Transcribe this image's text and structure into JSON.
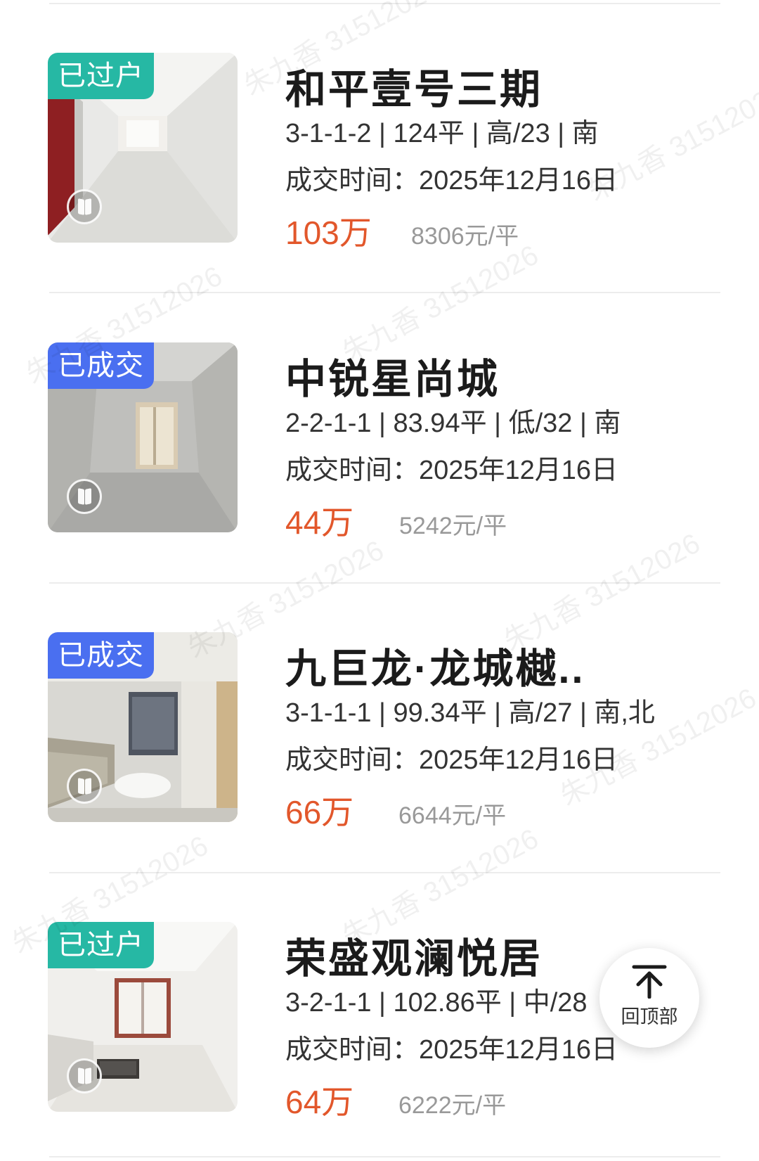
{
  "listings": [
    {
      "status": "已过户",
      "title": "和平壹号三期",
      "specs": "3-1-1-2 | 124平 | 高/23 | 南",
      "deal_date": "成交时间：2025年12月16日",
      "price": "103万",
      "unit_price": "8306元/平",
      "status_color": "#26b8a4"
    },
    {
      "status": "已成交",
      "title": "中锐星尚城",
      "specs": "2-2-1-1 | 83.94平 | 低/32 | 南",
      "deal_date": "成交时间：2025年12月16日",
      "price": "44万",
      "unit_price": "5242元/平",
      "status_color": "#4a6ff0"
    },
    {
      "status": "已成交",
      "title": "九巨龙·龙城樾..",
      "specs": "3-1-1-1 | 99.34平 | 高/27 | 南,北",
      "deal_date": "成交时间：2025年12月16日",
      "price": "66万",
      "unit_price": "6644元/平",
      "status_color": "#4a6ff0"
    },
    {
      "status": "已过户",
      "title": "荣盛观澜悦居",
      "specs": "3-2-1-1 | 102.86平 | 中/28",
      "deal_date": "成交时间：2025年12月16日",
      "price": "64万",
      "unit_price": "6222元/平",
      "status_color": "#26b8a4"
    }
  ],
  "back_to_top": {
    "label": "回顶部",
    "icon": "arrow-up-icon"
  },
  "watermark": {
    "text": "朱九香 31512026"
  },
  "colors": {
    "price": "#e2572b",
    "unit_price": "#999999",
    "tag_transferred": "#26b8a4",
    "tag_sold": "#4a6ff0"
  }
}
